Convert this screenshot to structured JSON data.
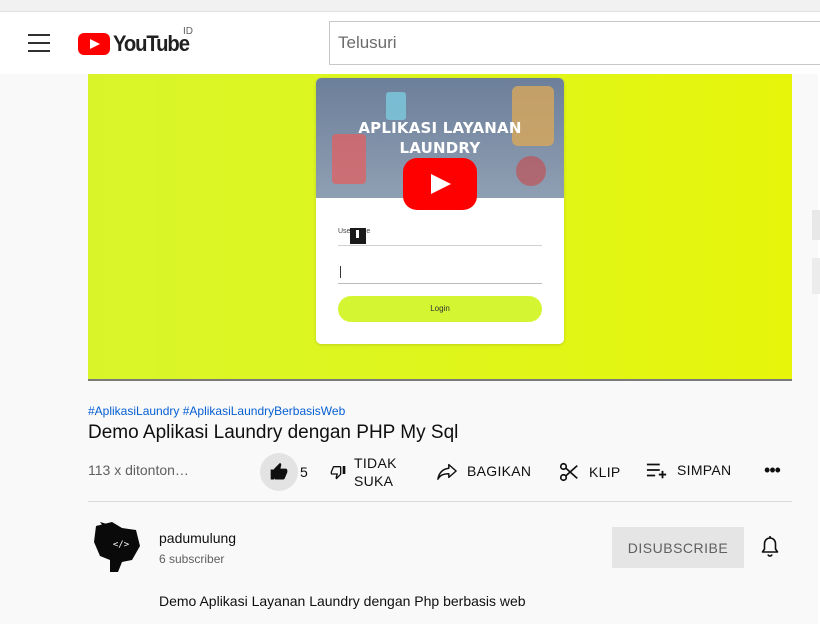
{
  "masthead": {
    "logo_text": "YouTube",
    "country_code": "ID",
    "search_placeholder": "Telusuri"
  },
  "player": {
    "thumbnail_title": "APLIKASI LAYANAN LAUNDRY",
    "field_label": "Username",
    "login_label": "Login"
  },
  "video": {
    "hashtags": [
      "#AplikasiLaundry",
      "#AplikasiLaundryBerbasisWeb"
    ],
    "title": "Demo Aplikasi Laundry dengan PHP My Sql",
    "views": "113 x ditonton…"
  },
  "actions": {
    "like_count": "5",
    "dislike_label": "TIDAK SUKA",
    "share_label": "BAGIKAN",
    "clip_label": "KLIP",
    "save_label": "SIMPAN",
    "more_label": "•••"
  },
  "channel": {
    "name": "padumulung",
    "subscribers": "6 subscriber",
    "unsubscribe_label": "DISUBSCRIBE",
    "description": "Demo Aplikasi Layanan Laundry dengan Php berbasis web"
  },
  "colors": {
    "brand_red": "#ff0000",
    "link_blue": "#065fd4",
    "player_lime": "#dff61c"
  }
}
